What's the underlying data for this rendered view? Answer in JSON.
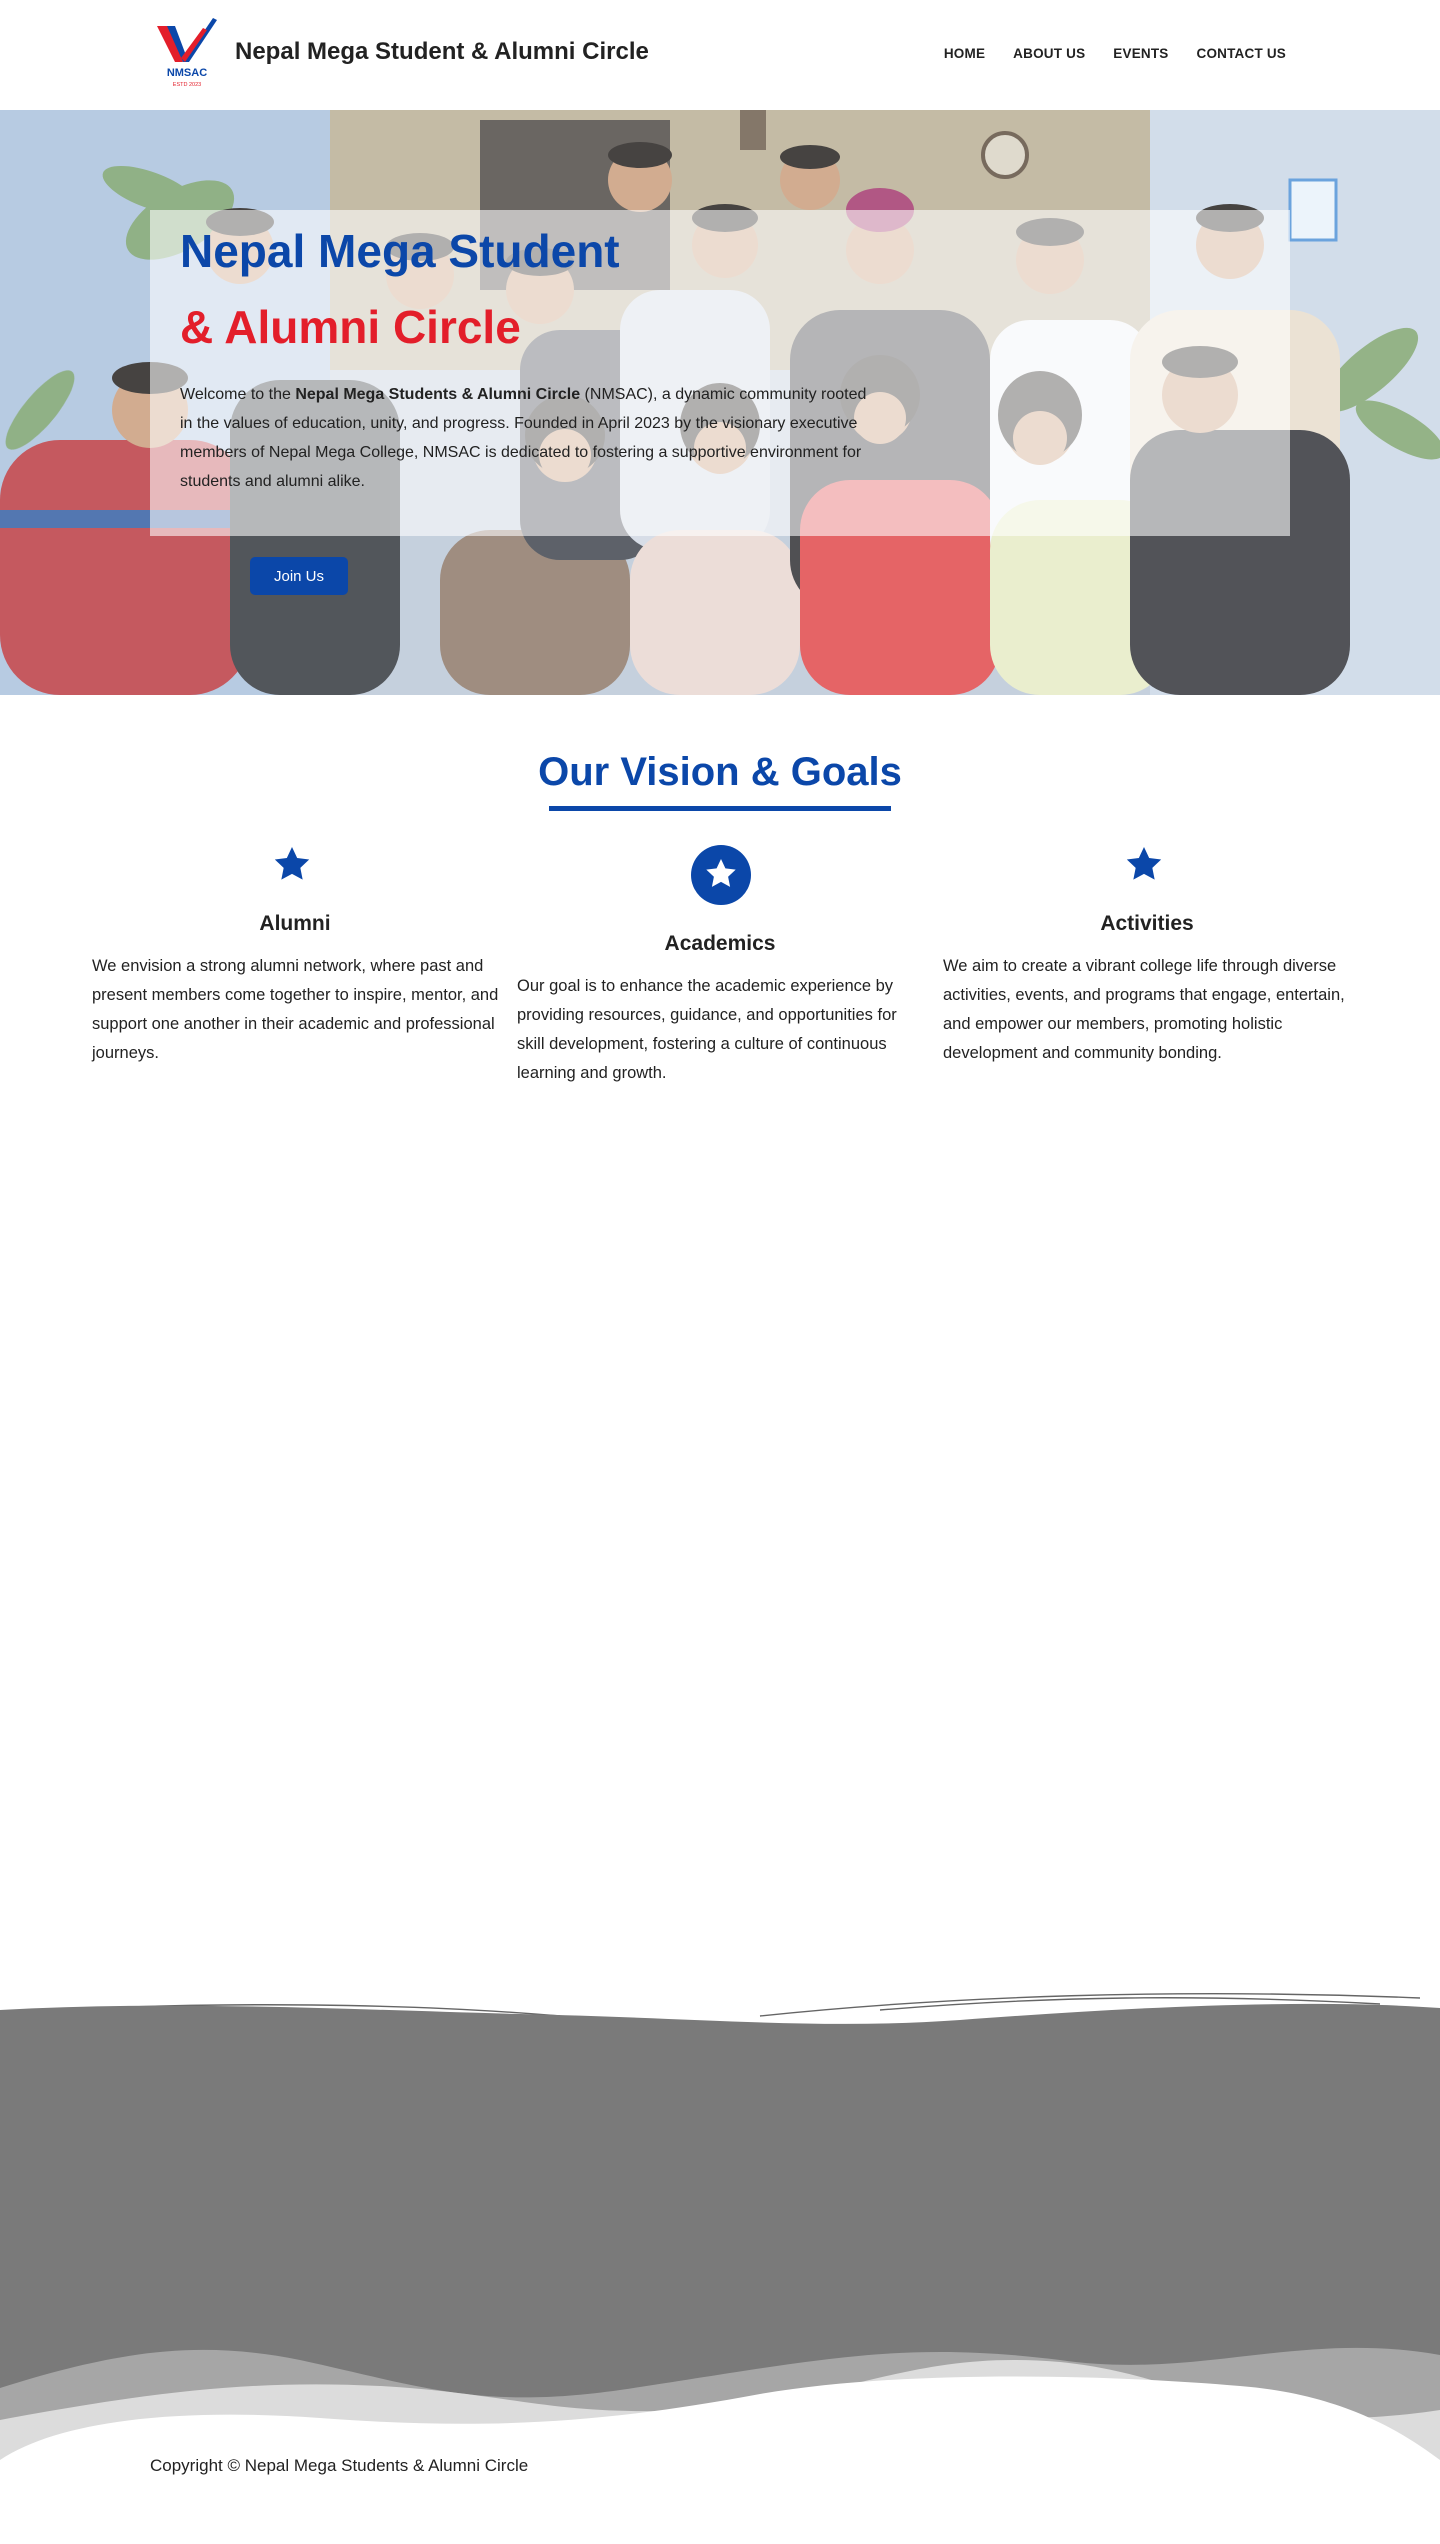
{
  "header": {
    "logo_text": "NMSAC",
    "logo_subtext": "ESTD 2023",
    "site_title": "Nepal Mega Student & Alumni Circle",
    "nav": [
      "HOME",
      "ABOUT US",
      "EVENTS",
      "CONTACT US"
    ]
  },
  "hero": {
    "title_line1": "Nepal Mega Student",
    "title_line2": "& Alumni Circle",
    "text_prefix": "Welcome to the ",
    "text_bold": "Nepal Mega Students & Alumni Circle",
    "text_suffix": " (NMSAC), a dynamic community rooted in the values of education, unity, and progress. Founded in April 2023 by the visionary executive members of Nepal Mega College, NMSAC is dedicated to fostering a supportive environment for students and alumni alike.",
    "join_label": "Join Us"
  },
  "vision": {
    "title": "Our Vision & Goals",
    "columns": [
      {
        "icon": "star-icon",
        "title": "Alumni",
        "text": "We envision a strong alumni network, where past and present members come together to inspire, mentor, and support one another in their academic and professional journeys."
      },
      {
        "icon": "star-circle-icon",
        "title": "Academics",
        "text": "Our goal is to enhance the academic experience by providing resources, guidance, and opportunities for skill development, fostering a culture of continuous learning and growth."
      },
      {
        "icon": "star-icon",
        "title": "Activities",
        "text": "We aim to create a vibrant college life through diverse activities, events, and programs that engage, entertain, and empower our members, promoting holistic development and community bonding."
      }
    ]
  },
  "footer": {
    "copyright": "Copyright © Nepal Mega Students & Alumni Circle"
  },
  "colors": {
    "brand_blue": "#0b47a9",
    "brand_red": "#e31e2a",
    "footer_gray": "#7a7a7a"
  }
}
